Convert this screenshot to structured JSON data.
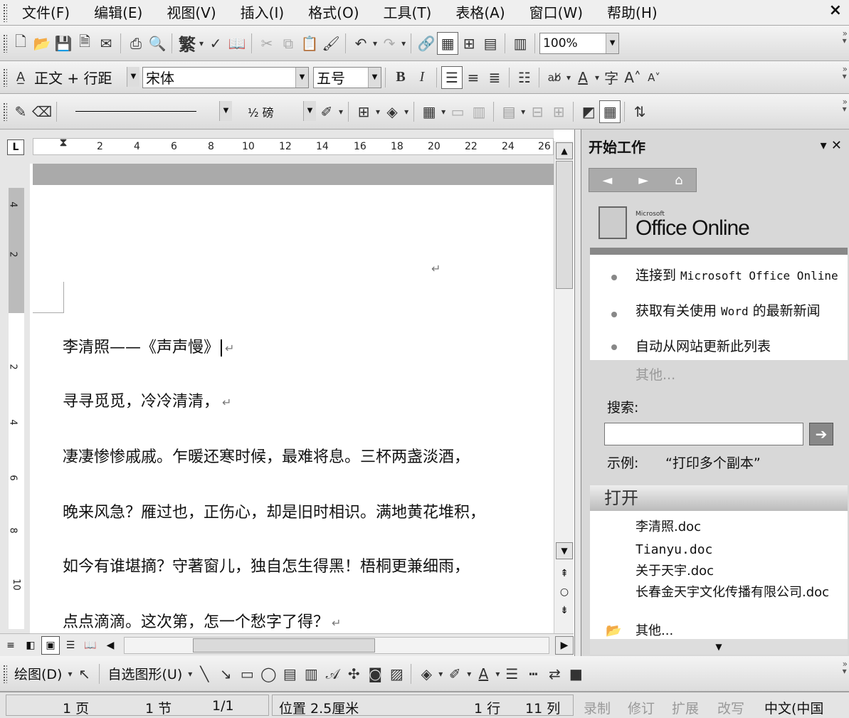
{
  "menu": {
    "items": [
      "文件(F)",
      "编辑(E)",
      "视图(V)",
      "插入(I)",
      "格式(O)",
      "工具(T)",
      "表格(A)",
      "窗口(W)",
      "帮助(H)"
    ],
    "close_glyph": "×"
  },
  "standard_toolbar": {
    "traditional_label": "繁",
    "zoom": "100%"
  },
  "format_toolbar": {
    "style": "正文 + 行距",
    "font": "宋体",
    "size": "五号",
    "bold": "B",
    "italic": "I"
  },
  "tables_toolbar": {
    "line_weight": "½ 磅"
  },
  "ruler": {
    "tab_selector": "L",
    "numbers": [
      "2",
      "4",
      "6",
      "8",
      "10",
      "12",
      "14",
      "16",
      "18",
      "20",
      "22",
      "24",
      "26"
    ],
    "vertical_numbers": [
      "4",
      "2",
      "2",
      "4",
      "6",
      "8",
      "10"
    ]
  },
  "document": {
    "para_mark": "↵",
    "lines": [
      "李清照——《声声慢》",
      "寻寻觅觅，冷冷清清，",
      "凄凄惨惨戚戚。乍暖还寒时候，最难将息。三杯两盏淡酒，",
      "晚来风急？雁过也，正伤心，却是旧时相识。满地黄花堆积，",
      "如今有谁堪摘？守著窗儿，独自怎生得黑！梧桐更兼细雨，",
      "点点滴滴。这次第，怎一个愁字了得？"
    ]
  },
  "taskpane": {
    "title": "开始工作",
    "logo_small": "Microsoft",
    "logo_text": "Office Online",
    "links": [
      {
        "pre": "连接到 ",
        "mono": "Microsoft Office Online",
        "post": ""
      },
      {
        "pre": "获取有关使用 ",
        "mono": "Word",
        "post": " 的最新新闻"
      },
      {
        "pre": "自动从网站更新此列表",
        "mono": "",
        "post": ""
      }
    ],
    "more_link": "其他...",
    "search_label": "搜索:",
    "search_value": "",
    "example_label": "示例:",
    "example_value": "“打印多个副本”",
    "open_header": "打开",
    "files": [
      "李清照.doc",
      "Tianyu.doc",
      "关于天宇.doc",
      "长春金天宇文化传播有限公司.doc"
    ],
    "open_more": "其他..."
  },
  "drawing_toolbar": {
    "draw": "绘图(D)",
    "autoshapes": "自选图形(U)"
  },
  "status": {
    "page": "1 页",
    "section": "1 节",
    "pages": "1/1",
    "position": "位置 2.5厘米",
    "line": "1 行",
    "column": "11 列",
    "rec": "录制",
    "trk": "修订",
    "ext": "扩展",
    "ovr": "改写",
    "language": "中文(中国"
  }
}
